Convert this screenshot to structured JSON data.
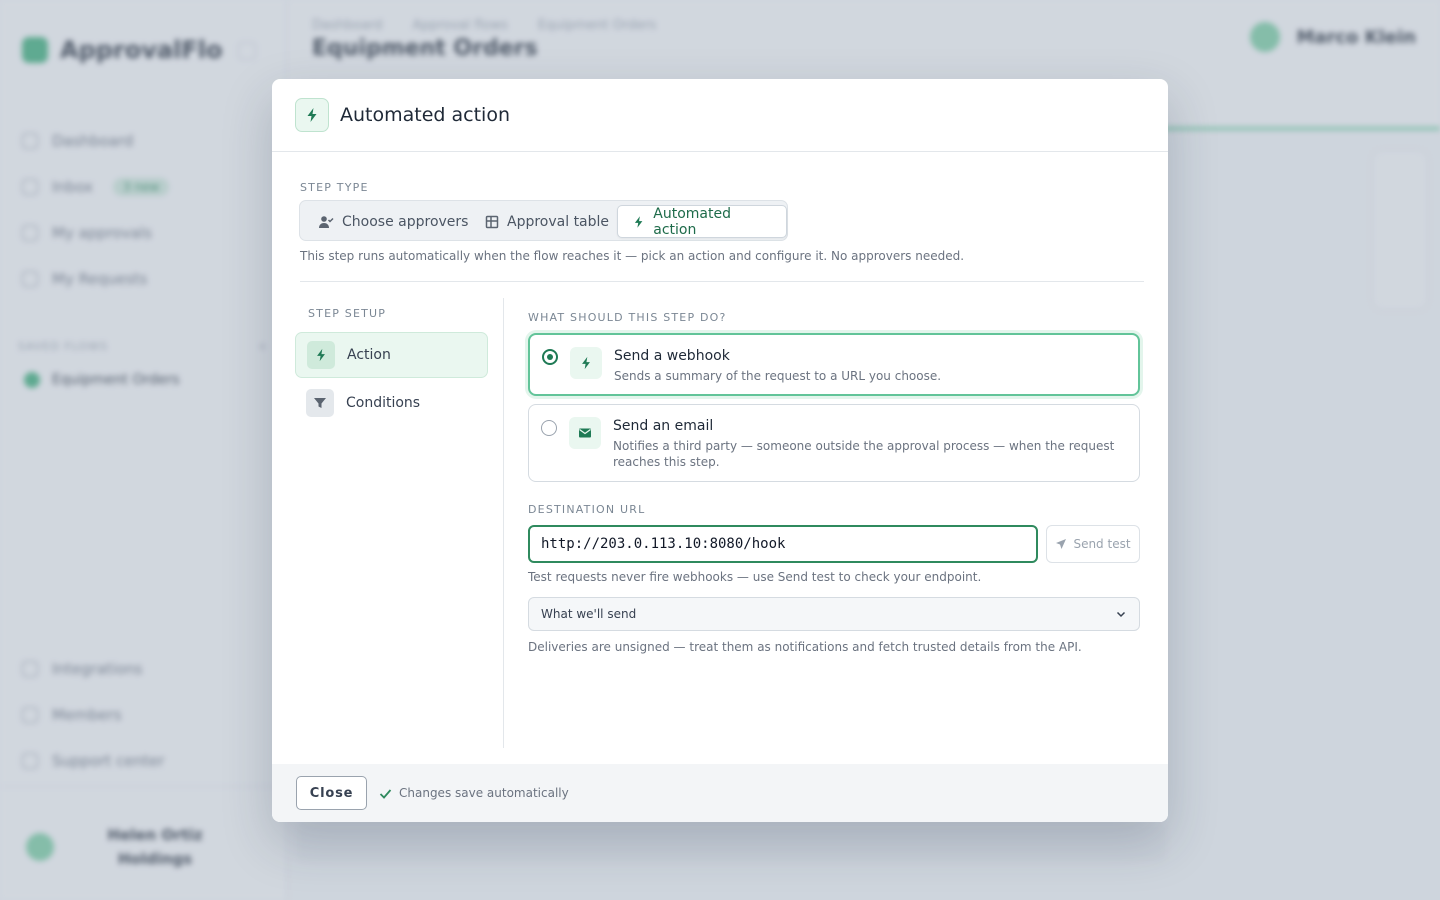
{
  "background": {
    "brand": "ApprovalFlo",
    "nav": [
      {
        "label": "Dashboard"
      },
      {
        "label": "Inbox",
        "badge": "3 new"
      },
      {
        "label": "My approvals"
      },
      {
        "label": "My Requests"
      }
    ],
    "section_label": "SAVED FLOWS",
    "flow_item": "Equipment Orders",
    "nav_bottom": [
      {
        "label": "Integrations"
      },
      {
        "label": "Members"
      },
      {
        "label": "Support center"
      }
    ],
    "user_name": "Helen Ortiz Holdings",
    "breadcrumbs": [
      "Dashboard",
      "Approval flows",
      "Equipment Orders"
    ],
    "page_title": "Equipment Orders",
    "top_user_name": "Marco Klein"
  },
  "modal": {
    "title": "Automated action",
    "step_type_label": "STEP TYPE",
    "step_types": [
      {
        "label": "Choose approvers"
      },
      {
        "label": "Approval table"
      },
      {
        "label": "Automated action"
      }
    ],
    "step_type_help": "This step runs automatically when the flow reaches it — pick an action and configure it. No approvers needed.",
    "setup_label": "STEP SETUP",
    "setup_items": [
      {
        "label": "Action"
      },
      {
        "label": "Conditions"
      }
    ],
    "what_label": "WHAT SHOULD THIS STEP DO?",
    "options": [
      {
        "title": "Send a webhook",
        "description": "Sends a summary of the request to a URL you choose.",
        "selected": true
      },
      {
        "title": "Send an email",
        "description": "Notifies a third party — someone outside the approval process — when the request reaches this step.",
        "selected": false
      }
    ],
    "url_label": "DESTINATION URL",
    "url_value": "http://203.0.113.10:8080/hook",
    "send_test_label": "Send test",
    "url_help": "Test requests never fire webhooks — use Send test to check your endpoint.",
    "disclosure_label": "What we'll send",
    "unsigned_note": "Deliveries are unsigned — treat them as notifications and fetch trusted details from the API.",
    "close_label": "Close",
    "autosave_label": "Changes save automatically"
  },
  "colors": {
    "accent": "#1f7a55",
    "accent_light": "#eaf7f0",
    "selected_border": "#62c499"
  }
}
